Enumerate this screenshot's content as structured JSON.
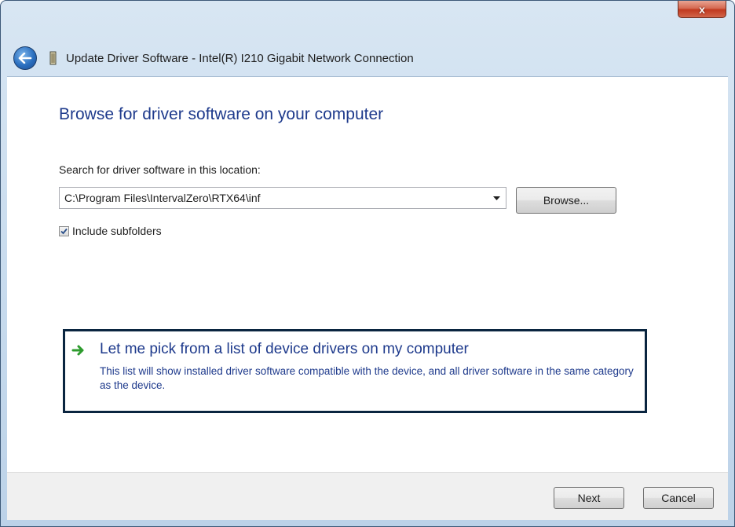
{
  "window": {
    "title": "Update Driver Software - Intel(R) I210 Gigabit Network Connection",
    "close_label": "x"
  },
  "main": {
    "heading": "Browse for driver software on your computer",
    "search_label": "Search for driver software in this location:",
    "path_value": "C:\\Program Files\\IntervalZero\\RTX64\\inf",
    "browse_label": "Browse...",
    "include_subfolders_label": "Include subfolders",
    "include_subfolders_checked": true
  },
  "pick_option": {
    "title": "Let me pick from a list of device drivers on my computer",
    "description": "This list will show installed driver software compatible with the device, and all driver software in the same category as the device."
  },
  "footer": {
    "next_label": "Next",
    "cancel_label": "Cancel"
  },
  "colors": {
    "heading_blue": "#1e3a8c",
    "link_arrow_green": "#2e9b2e",
    "close_red": "#c0391f"
  },
  "icons": [
    "back-arrow-icon",
    "network-adapter-icon",
    "dropdown-arrow-icon",
    "checkmark-icon",
    "green-arrow-icon"
  ]
}
